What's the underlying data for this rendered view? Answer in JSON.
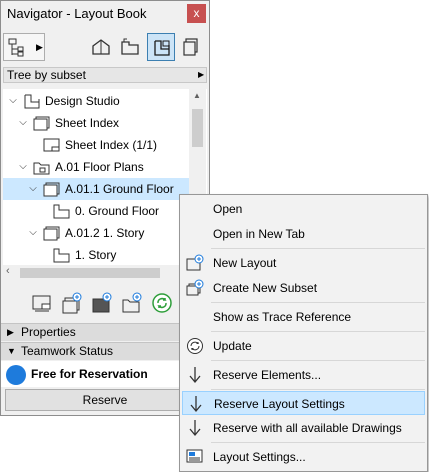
{
  "window": {
    "title": "Navigator - Layout Book",
    "close_glyph": "x"
  },
  "toolbar": {
    "icons": [
      "project-map-icon",
      "view-map-icon",
      "layout-book-icon",
      "publisher-sets-icon"
    ]
  },
  "subset": {
    "label": "Tree by subset"
  },
  "tree": {
    "items": [
      {
        "label": "Design Studio",
        "icon": "layout-book-icon",
        "expanded": true
      },
      {
        "label": "Sheet Index",
        "icon": "subset-icon",
        "expanded": true
      },
      {
        "label": "Sheet Index (1/1)",
        "icon": "layout-icon"
      },
      {
        "label": "A.01 Floor Plans",
        "icon": "subset-folder-icon",
        "expanded": true
      },
      {
        "label": "A.01.1 Ground Floor",
        "icon": "subset-icon",
        "expanded": true,
        "selected": true
      },
      {
        "label": "0. Ground Floor",
        "icon": "drawing-icon"
      },
      {
        "label": "A.01.2 1. Story",
        "icon": "subset-icon",
        "expanded": true
      },
      {
        "label": "1. Story",
        "icon": "drawing-icon"
      }
    ]
  },
  "panels": {
    "properties": "Properties",
    "teamwork": "Teamwork Status"
  },
  "teamwork": {
    "status": "Free for Reservation",
    "status_color": "#1e7bdc",
    "reserve_button": "Reserve"
  },
  "context_menu": {
    "items": [
      {
        "label": "Open",
        "icon": ""
      },
      {
        "label": "Open in New Tab",
        "icon": ""
      },
      {
        "label": "New Layout",
        "icon": "new-layout-icon"
      },
      {
        "label": "Create New Subset",
        "icon": "new-subset-icon"
      },
      {
        "label": "Show as Trace Reference",
        "icon": ""
      },
      {
        "label": "Update",
        "icon": "update-icon"
      },
      {
        "label": "Reserve Elements...",
        "icon": "reserve-arrow-icon"
      },
      {
        "label": "Reserve Layout Settings",
        "icon": "reserve-arrow-icon",
        "highlighted": true
      },
      {
        "label": "Reserve with all available Drawings",
        "icon": "reserve-arrow-icon"
      },
      {
        "label": "Layout Settings...",
        "icon": "layout-settings-icon"
      }
    ]
  },
  "colors": {
    "selection": "#cce8ff",
    "accent": "#1e7bdc",
    "close": "#c75050"
  }
}
